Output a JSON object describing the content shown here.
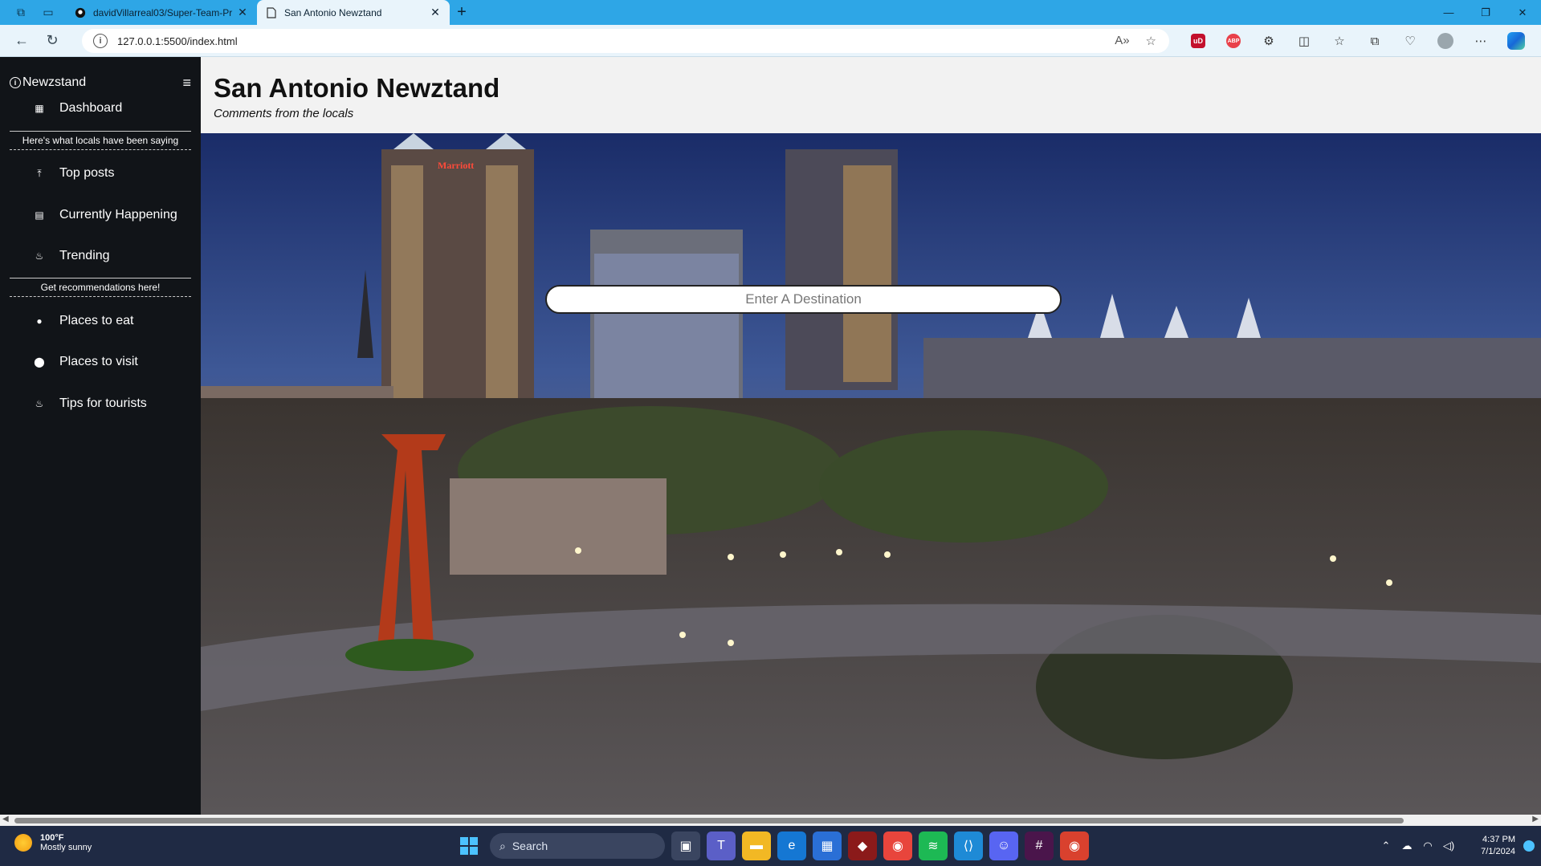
{
  "browser": {
    "tabs": [
      {
        "title": "davidVillarreal03/Super-Team-Pr",
        "active": false
      },
      {
        "title": "San Antonio Newztand",
        "active": true
      }
    ],
    "url": "127.0.0.1:5500/index.html"
  },
  "sidebar": {
    "brand": "Newzstand",
    "items": [
      {
        "label": "Dashboard",
        "icon": "grid-icon"
      },
      {
        "label": "Top posts",
        "icon": "pin-icon"
      },
      {
        "label": "Currently Happening",
        "icon": "news-icon"
      },
      {
        "label": "Trending",
        "icon": "flame-icon"
      },
      {
        "label": "Places to eat",
        "icon": "food-icon"
      },
      {
        "label": "Places to visit",
        "icon": "location-icon"
      },
      {
        "label": "Tips for tourists",
        "icon": "flame-icon"
      }
    ],
    "section1": "Here's what locals have been saying",
    "section2": "Get recommendations here!"
  },
  "header": {
    "title": "San Antonio Newztand",
    "subtitle": "Comments from the locals"
  },
  "hero": {
    "search_placeholder": "Enter A Destination",
    "sign_text": "Marriott"
  },
  "taskbar": {
    "temp": "100°F",
    "condition": "Mostly sunny",
    "search": "Search",
    "time": "4:37 PM",
    "date": "7/1/2024"
  }
}
